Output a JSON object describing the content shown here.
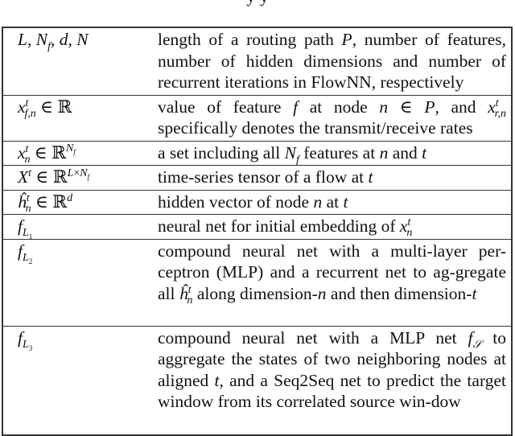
{
  "caption_tail": "y y",
  "table": {
    "rows": [
      {
        "symbol": "L, N_f, d, N",
        "symbol_html": "<span class='m'>L</span>, <span class='m'>N</span><sub class='m'>f</sub>, <span class='m'>d</span>, <span class='m'>N</span>",
        "description": "length of a routing path P, number of features, number of hidden dimensions and number of recurrent iterations in FlowNN, respectively",
        "description_html": "length of a routing path <span class='m'>P</span>, number of features, number of hidden dimensions and number of recurrent iterations in FlowNN, respectively"
      },
      {
        "symbol": "x^t_{f,n} ∈ ℝ",
        "symbol_html": "<span class='m'>x</span><sup class='m'>t</sup><sub class='m' style='margin-left:-5px'>f,n</sub> ∈ ℝ",
        "description": "value of feature f at node n ∈ P, and x^t_{r,n} specifically denotes the transmit/receive rates",
        "description_html": "value of feature <span class='m'>f</span> at node <span class='m'>n</span> ∈ <span class='m'>P</span>, and <span class='m'>x</span><sup class='m'>t</sup><sub class='m' style='margin-left:-5px'>r,n</sub> specifically denotes the transmit/receive rates"
      },
      {
        "symbol": "x^t_n ∈ ℝ^{N_f}",
        "symbol_html": "<span class='m'>x</span><sup class='m'>t</sup><sub class='m' style='margin-left:-5px'>n</sub> ∈ ℝ<sup><span class='m'>N</span><sub class='m'>f</sub></sup>",
        "description": "a set including all N_f features at n and t",
        "description_html": "a set including all <span class='m'>N</span><sub class='m'>f</sub> features at <span class='m'>n</span> and <span class='m'>t</span>"
      },
      {
        "symbol": "X^t ∈ ℝ^{L×N_f}",
        "symbol_html": "<span class='m'>X</span><sup class='m'>t</sup> ∈ ℝ<sup><span class='m'>L</span>×<span class='m'>N</span><sub class='m'>f</sub></sup>",
        "description": "time-series tensor of a flow at t",
        "description_html": "time-series tensor of a flow at <span class='m'>t</span>"
      },
      {
        "symbol": "ĥ^t_n ∈ ℝ^d",
        "symbol_html": "<span class='m'>ĥ</span><sup class='m'>t</sup><sub class='m' style='margin-left:-5px'>n</sub> ∈ ℝ<sup class='m'>d</sup>",
        "description": "hidden vector of node n at t",
        "description_html": "hidden vector of node <span class='m'>n</span> at <span class='m'>t</span>"
      },
      {
        "symbol": "f_{L_1}",
        "symbol_html": "<span class='m'>f</span><sub><span class='m'>L</span><sub>1</sub></sub>",
        "description": "neural net for initial embedding of x^t_n",
        "description_html": "neural net for initial embedding of <span class='m'>x</span><sup class='m'>t</sup><sub class='m' style='margin-left:-5px'>n</sub>"
      },
      {
        "symbol": "f_{L_2}",
        "symbol_html": "<span class='m'>f</span><sub><span class='m'>L</span><sub>2</sub></sub>",
        "description": "compound neural net with a multi-layer perceptron (MLP) and a recurrent net to aggregate all ĥ^t_n along dimension-n and then dimension-t",
        "description_html": "compound neural net with a multi-layer per-ceptron (MLP) and a recurrent net to ag-gregate all <span class='m'>ĥ</span><sup class='m'>t</sup><sub class='m' style='margin-left:-5px'>n</sub> along dimension-<span class='m'>n</span> and then dimension-<span class='m'>t</span>"
      },
      {
        "symbol": "f_{L_3}",
        "symbol_html": "<span class='m'>f</span><sub><span class='m'>L</span><sub>3</sub></sub>",
        "description": "compound neural net with a MLP net f_S to aggregate the states of two neighboring nodes at aligned t, and a Seq2Seq net to predict the target window from its correlated source window",
        "description_html": "compound neural net with a MLP net <span class='m'>f</span><sub class='m'>𝒮</sub> to aggregate the states of two neighboring nodes at aligned <span class='m'>t</span>, and a Seq2Seq net to predict the target window from its correlated source win-dow"
      }
    ]
  }
}
